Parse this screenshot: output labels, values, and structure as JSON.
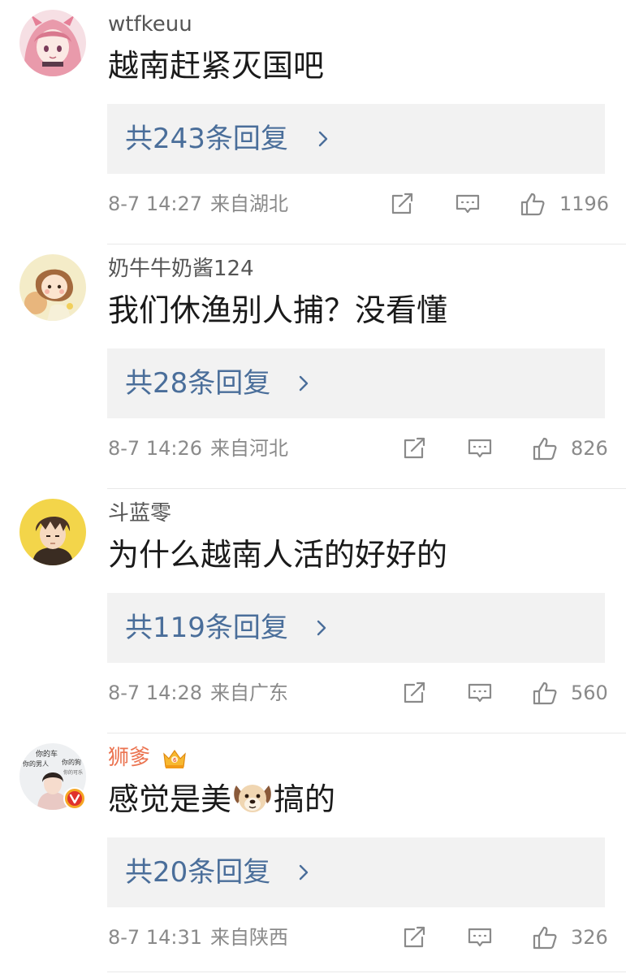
{
  "comments": [
    {
      "username": "wtfkeuu",
      "content": "越南赶紧灭国吧",
      "reply_count_label": "共243条回复",
      "time": "8-7 14:27",
      "location": "来自湖北",
      "likes": "1196",
      "avatar_icon": "anime-pink-hair-avatar"
    },
    {
      "username": "奶牛牛奶酱124",
      "content": "我们休渔别人捕？没看懂",
      "reply_count_label": "共28条回复",
      "time": "8-7 14:26",
      "location": "来自河北",
      "likes": "826",
      "avatar_icon": "cartoon-girl-avatar"
    },
    {
      "username": "斗蓝零",
      "content": "为什么越南人活的好好的",
      "reply_count_label": "共119条回复",
      "time": "8-7 14:28",
      "location": "来自广东",
      "likes": "560",
      "avatar_icon": "anime-boy-avatar"
    },
    {
      "username": "狮爹",
      "content_before_emoji": "感觉是美",
      "content_emoji": "dog-face-emoji",
      "content_after_emoji": "搞的",
      "reply_count_label": "共20条回复",
      "time": "8-7 14:31",
      "location": "来自陕西",
      "likes": "326",
      "avatar_icon": "photo-avatar-verified",
      "avatar_text_lines": [
        "你的车",
        "你的男人",
        "你的狗",
        "你的可乐"
      ],
      "badge_icon": "vip-crown-icon",
      "verified_icon": "verified-v-badge"
    }
  ],
  "colors": {
    "reply_link": "#4a6e9a",
    "vip_name": "#eb7350",
    "meta_text": "#8a8a8a",
    "reply_bg": "#f2f2f2"
  }
}
